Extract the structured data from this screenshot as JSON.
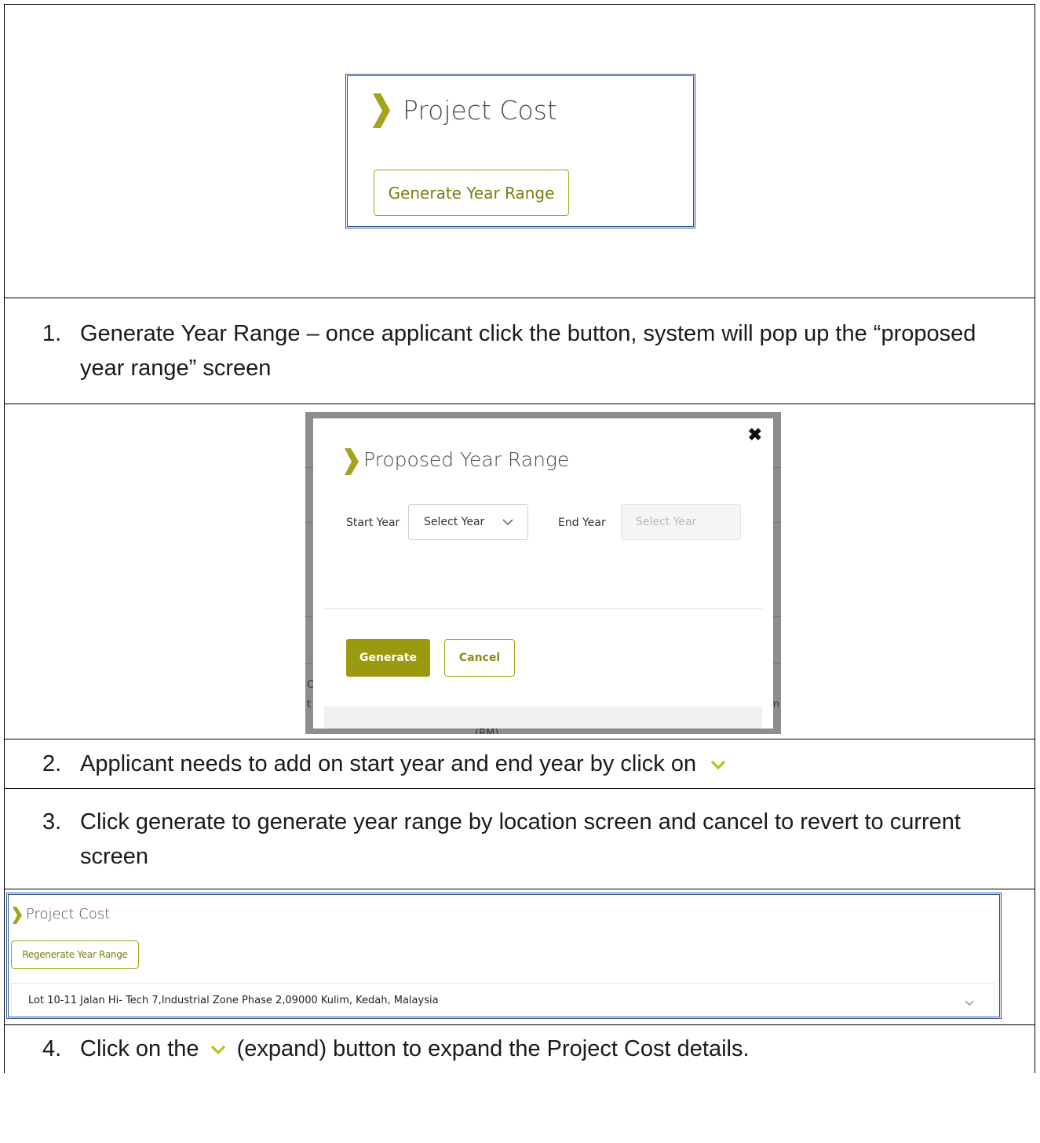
{
  "shot1": {
    "title": "Project Cost",
    "button": "Generate Year Range"
  },
  "step1": {
    "number": "1.",
    "text": "Generate Year Range – once applicant click the button, system will pop up the “proposed year range” screen"
  },
  "modal": {
    "title": "Proposed Year Range",
    "start_label": "Start Year",
    "start_placeholder": "Select Year",
    "end_label": "End Year",
    "end_placeholder": "Select Year",
    "generate": "Generate",
    "cancel": "Cancel",
    "bg_fragment_rm": "(RM)",
    "bg_fragment_left_top": "C",
    "bg_fragment_left_bottom": "t",
    "bg_fragment_right": "n",
    "close_glyph": "✖"
  },
  "step2": {
    "number": "2.",
    "text": "Applicant needs to add on start year and end year by click on"
  },
  "step3": {
    "number": "3.",
    "text": "Click generate to generate year range by location screen and cancel to revert to current screen"
  },
  "shot3": {
    "title": "Project Cost",
    "button": "Regenerate Year Range",
    "location": "Lot 10-11 Jalan Hi- Tech 7,Industrial Zone Phase 2,09000 Kulim, Kedah, Malaysia"
  },
  "step4": {
    "number": "4.",
    "text_before": "Click on the",
    "text_after": "(expand) button to expand the Project Cost details."
  },
  "colors": {
    "olive": "#a3a41d",
    "olive_dark": "#9a9a10",
    "frame_blue": "#2f4f8f"
  },
  "icons": [
    "chevron-right-icon",
    "close-icon",
    "chevron-down-icon"
  ]
}
